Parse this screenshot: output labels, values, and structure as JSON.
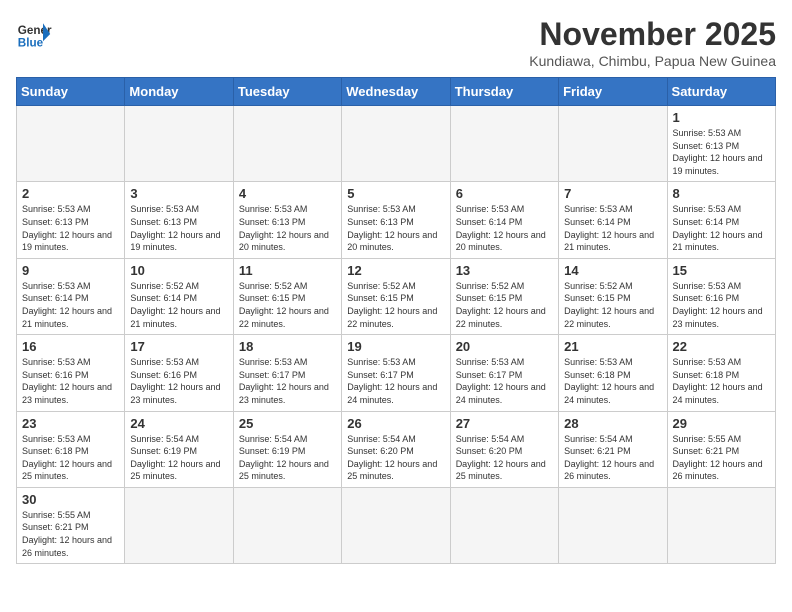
{
  "header": {
    "logo_general": "General",
    "logo_blue": "Blue",
    "title": "November 2025",
    "subtitle": "Kundiawa, Chimbu, Papua New Guinea"
  },
  "days_of_week": [
    "Sunday",
    "Monday",
    "Tuesday",
    "Wednesday",
    "Thursday",
    "Friday",
    "Saturday"
  ],
  "weeks": [
    [
      {
        "day": "",
        "empty": true
      },
      {
        "day": "",
        "empty": true
      },
      {
        "day": "",
        "empty": true
      },
      {
        "day": "",
        "empty": true
      },
      {
        "day": "",
        "empty": true
      },
      {
        "day": "",
        "empty": true
      },
      {
        "day": "1",
        "sunrise": "5:53 AM",
        "sunset": "6:13 PM",
        "daylight": "12 hours and 19 minutes."
      }
    ],
    [
      {
        "day": "2",
        "sunrise": "5:53 AM",
        "sunset": "6:13 PM",
        "daylight": "12 hours and 19 minutes."
      },
      {
        "day": "3",
        "sunrise": "5:53 AM",
        "sunset": "6:13 PM",
        "daylight": "12 hours and 19 minutes."
      },
      {
        "day": "4",
        "sunrise": "5:53 AM",
        "sunset": "6:13 PM",
        "daylight": "12 hours and 20 minutes."
      },
      {
        "day": "5",
        "sunrise": "5:53 AM",
        "sunset": "6:13 PM",
        "daylight": "12 hours and 20 minutes."
      },
      {
        "day": "6",
        "sunrise": "5:53 AM",
        "sunset": "6:14 PM",
        "daylight": "12 hours and 20 minutes."
      },
      {
        "day": "7",
        "sunrise": "5:53 AM",
        "sunset": "6:14 PM",
        "daylight": "12 hours and 21 minutes."
      },
      {
        "day": "8",
        "sunrise": "5:53 AM",
        "sunset": "6:14 PM",
        "daylight": "12 hours and 21 minutes."
      }
    ],
    [
      {
        "day": "9",
        "sunrise": "5:53 AM",
        "sunset": "6:14 PM",
        "daylight": "12 hours and 21 minutes."
      },
      {
        "day": "10",
        "sunrise": "5:52 AM",
        "sunset": "6:14 PM",
        "daylight": "12 hours and 21 minutes."
      },
      {
        "day": "11",
        "sunrise": "5:52 AM",
        "sunset": "6:15 PM",
        "daylight": "12 hours and 22 minutes."
      },
      {
        "day": "12",
        "sunrise": "5:52 AM",
        "sunset": "6:15 PM",
        "daylight": "12 hours and 22 minutes."
      },
      {
        "day": "13",
        "sunrise": "5:52 AM",
        "sunset": "6:15 PM",
        "daylight": "12 hours and 22 minutes."
      },
      {
        "day": "14",
        "sunrise": "5:52 AM",
        "sunset": "6:15 PM",
        "daylight": "12 hours and 22 minutes."
      },
      {
        "day": "15",
        "sunrise": "5:53 AM",
        "sunset": "6:16 PM",
        "daylight": "12 hours and 23 minutes."
      }
    ],
    [
      {
        "day": "16",
        "sunrise": "5:53 AM",
        "sunset": "6:16 PM",
        "daylight": "12 hours and 23 minutes."
      },
      {
        "day": "17",
        "sunrise": "5:53 AM",
        "sunset": "6:16 PM",
        "daylight": "12 hours and 23 minutes."
      },
      {
        "day": "18",
        "sunrise": "5:53 AM",
        "sunset": "6:17 PM",
        "daylight": "12 hours and 23 minutes."
      },
      {
        "day": "19",
        "sunrise": "5:53 AM",
        "sunset": "6:17 PM",
        "daylight": "12 hours and 24 minutes."
      },
      {
        "day": "20",
        "sunrise": "5:53 AM",
        "sunset": "6:17 PM",
        "daylight": "12 hours and 24 minutes."
      },
      {
        "day": "21",
        "sunrise": "5:53 AM",
        "sunset": "6:18 PM",
        "daylight": "12 hours and 24 minutes."
      },
      {
        "day": "22",
        "sunrise": "5:53 AM",
        "sunset": "6:18 PM",
        "daylight": "12 hours and 24 minutes."
      }
    ],
    [
      {
        "day": "23",
        "sunrise": "5:53 AM",
        "sunset": "6:18 PM",
        "daylight": "12 hours and 25 minutes."
      },
      {
        "day": "24",
        "sunrise": "5:54 AM",
        "sunset": "6:19 PM",
        "daylight": "12 hours and 25 minutes."
      },
      {
        "day": "25",
        "sunrise": "5:54 AM",
        "sunset": "6:19 PM",
        "daylight": "12 hours and 25 minutes."
      },
      {
        "day": "26",
        "sunrise": "5:54 AM",
        "sunset": "6:20 PM",
        "daylight": "12 hours and 25 minutes."
      },
      {
        "day": "27",
        "sunrise": "5:54 AM",
        "sunset": "6:20 PM",
        "daylight": "12 hours and 25 minutes."
      },
      {
        "day": "28",
        "sunrise": "5:54 AM",
        "sunset": "6:21 PM",
        "daylight": "12 hours and 26 minutes."
      },
      {
        "day": "29",
        "sunrise": "5:55 AM",
        "sunset": "6:21 PM",
        "daylight": "12 hours and 26 minutes."
      }
    ],
    [
      {
        "day": "30",
        "sunrise": "5:55 AM",
        "sunset": "6:21 PM",
        "daylight": "12 hours and 26 minutes."
      },
      {
        "day": "",
        "empty": true
      },
      {
        "day": "",
        "empty": true
      },
      {
        "day": "",
        "empty": true
      },
      {
        "day": "",
        "empty": true
      },
      {
        "day": "",
        "empty": true
      },
      {
        "day": "",
        "empty": true
      }
    ]
  ]
}
